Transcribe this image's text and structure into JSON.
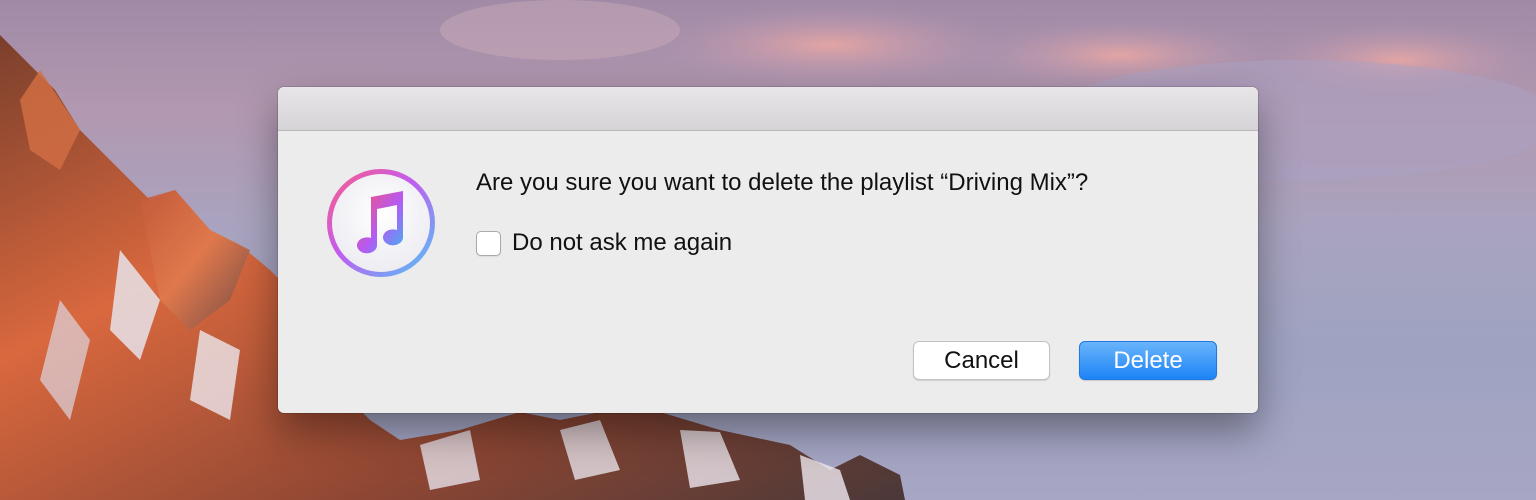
{
  "desktop": {
    "wallpaper_name": "mountain-sunset-wallpaper"
  },
  "dialog": {
    "icon_name": "music-app-icon",
    "message": "Are you sure you want to delete the playlist “Driving Mix”?",
    "checkbox": {
      "label": "Do not ask me again",
      "checked": false
    },
    "buttons": {
      "cancel_label": "Cancel",
      "delete_label": "Delete"
    },
    "colors": {
      "accent": "#1c84f6",
      "background": "#ececec"
    }
  }
}
